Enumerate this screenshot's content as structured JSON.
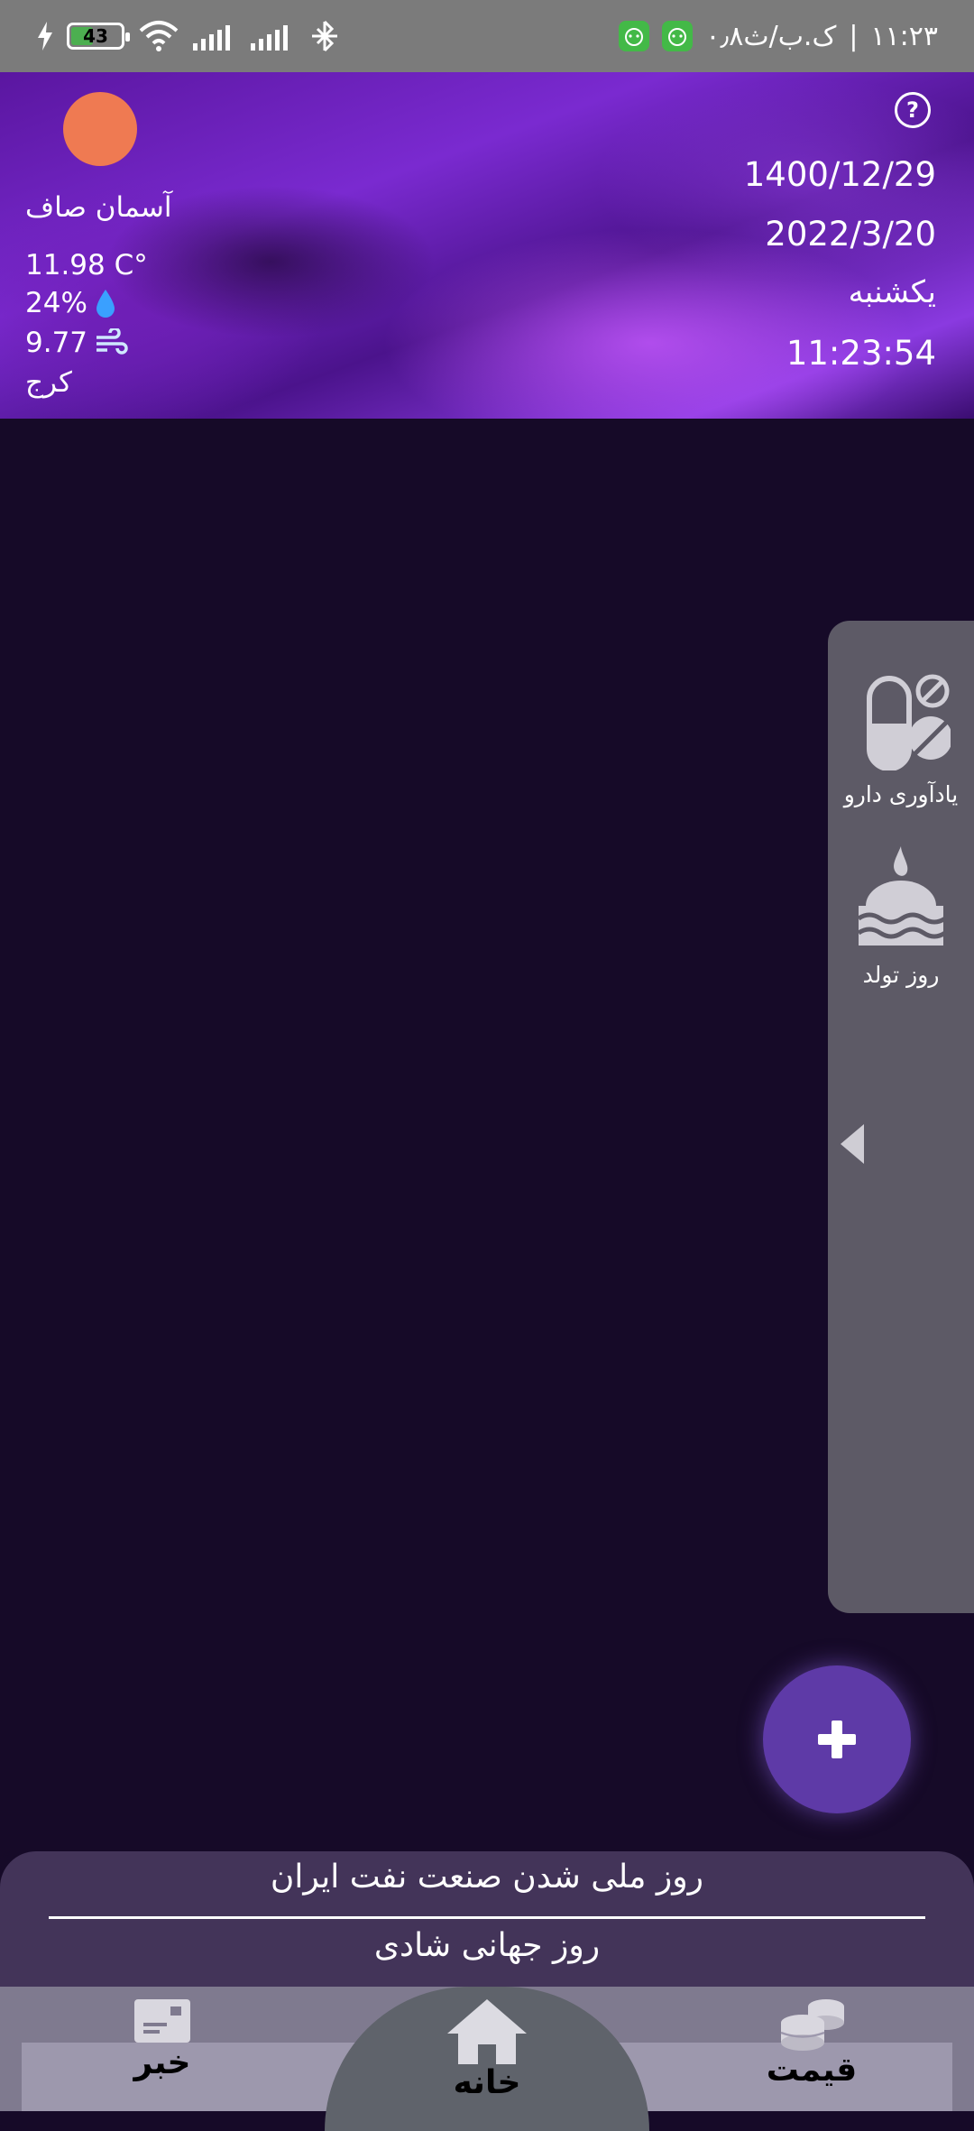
{
  "status_bar": {
    "time": "۱۱:۲۳",
    "network_speed": "۰٫۸ک.ب/ث",
    "battery": "43"
  },
  "header": {
    "weather": {
      "condition": "آسمان صاف",
      "temperature": "11.98 C°",
      "humidity": "24%",
      "wind": "9.77",
      "city": "کرج"
    },
    "persian_date": "1400/12/29",
    "gregorian_date": "2022/3/20",
    "weekday": "یکشنبه",
    "clock": "11:23:54"
  },
  "drawer": {
    "items": [
      {
        "label": "یادآوری دارو",
        "icon": "pills-icon"
      },
      {
        "label": "روز تولد",
        "icon": "cake-icon"
      }
    ]
  },
  "occasions": [
    "روز ملی شدن صنعت نفت ایران",
    "روز جهانی شادی"
  ],
  "nav": {
    "news": "خبر",
    "home": "خانه",
    "price": "قیمت"
  },
  "colors": {
    "background": "#160a28",
    "fab": "#5e3aa7",
    "drawer": "#5d5a66",
    "occasion_panel": "#433459",
    "sun": "#ef7a52"
  }
}
